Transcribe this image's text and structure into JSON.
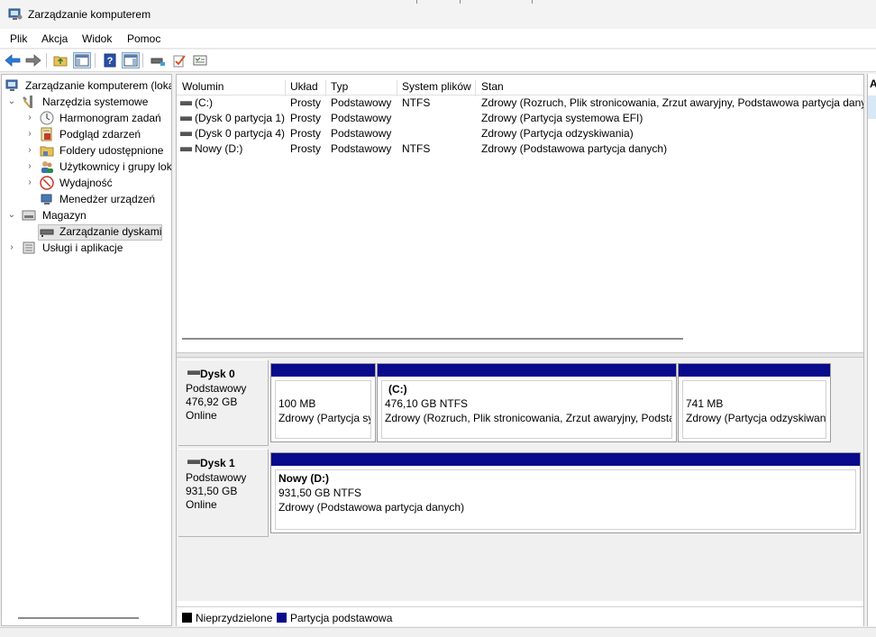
{
  "window": {
    "title": "Zarządzanie komputerem"
  },
  "menu": [
    "Plik",
    "Akcja",
    "Widok",
    "Pomoc"
  ],
  "tree": {
    "root": "Zarządzanie komputerem (loka",
    "system_tools": "Narzędzia systemowe",
    "task_scheduler": "Harmonogram zadań",
    "event_viewer": "Podgląd zdarzeń",
    "shared_folders": "Foldery udostępnione",
    "local_users": "Użytkownicy i grupy lok",
    "performance": "Wydajność",
    "device_manager": "Menedżer urządzeń",
    "storage": "Magazyn",
    "disk_management": "Zarządzanie dyskami",
    "services_apps": "Usługi i aplikacje"
  },
  "columns": [
    "Wolumin",
    "Układ",
    "Typ",
    "System plików",
    "Stan"
  ],
  "volumes": [
    {
      "name": "(C:)",
      "layout": "Prosty",
      "type": "Podstawowy",
      "fs": "NTFS",
      "status": "Zdrowy (Rozruch, Plik stronicowania, Zrzut awaryjny, Podstawowa partycja dany"
    },
    {
      "name": "(Dysk 0 partycja 1)",
      "layout": "Prosty",
      "type": "Podstawowy",
      "fs": "",
      "status": "Zdrowy (Partycja systemowa EFI)"
    },
    {
      "name": "(Dysk 0 partycja 4)",
      "layout": "Prosty",
      "type": "Podstawowy",
      "fs": "",
      "status": "Zdrowy (Partycja odzyskiwania)"
    },
    {
      "name": "Nowy (D:)",
      "layout": "Prosty",
      "type": "Podstawowy",
      "fs": "NTFS",
      "status": "Zdrowy (Podstawowa partycja danych)"
    }
  ],
  "disks": [
    {
      "name": "Dysk 0",
      "kind": "Podstawowy",
      "size": "476,92 GB",
      "state": "Online",
      "partitions": [
        {
          "title": "",
          "size": "100 MB",
          "status": "Zdrowy (Partycja sy"
        },
        {
          "title": "(C:)",
          "size": "476,10 GB NTFS",
          "status": "Zdrowy (Rozruch, Plik stronicowania, Zrzut awaryjny, Podsta"
        },
        {
          "title": "",
          "size": "741 MB",
          "status": "Zdrowy (Partycja odzyskiwan"
        }
      ]
    },
    {
      "name": "Dysk 1",
      "kind": "Podstawowy",
      "size": "931,50 GB",
      "state": "Online",
      "partitions": [
        {
          "title": "Nowy  (D:)",
          "size": "931,50 GB NTFS",
          "status": "Zdrowy (Podstawowa partycja danych)"
        }
      ]
    }
  ],
  "legend": [
    {
      "label": "Nieprzydzielone",
      "color": "#000000"
    },
    {
      "label": "Partycja podstawowa",
      "color": "#0a0a8c"
    }
  ],
  "actions_header": "A",
  "icons": [
    "computer-management-icon",
    "back-arrow-icon",
    "forward-arrow-icon",
    "up-folder-icon",
    "show-hide-tree-icon",
    "help-icon",
    "show-hide-action-pane-icon",
    "connect-drive-icon",
    "check-disk-icon",
    "properties-list-icon"
  ]
}
